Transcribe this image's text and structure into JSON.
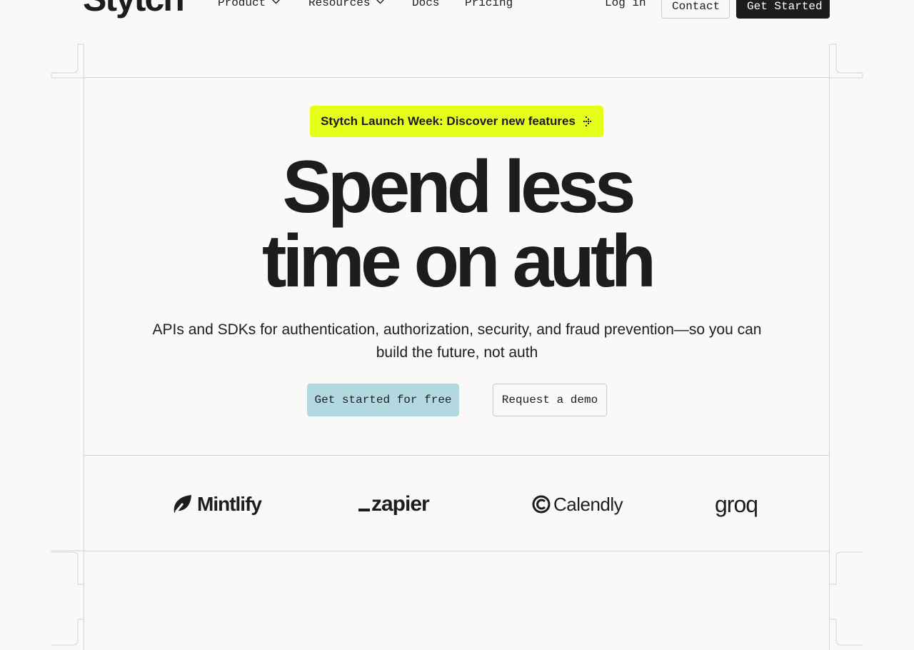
{
  "nav": {
    "logo": "Stytch",
    "links": [
      {
        "label": "Product",
        "has_dropdown": true
      },
      {
        "label": "Resources",
        "has_dropdown": true
      },
      {
        "label": "Docs",
        "has_dropdown": false
      },
      {
        "label": "Pricing",
        "has_dropdown": false
      }
    ],
    "login_label": "Log in",
    "contact_label": "Contact",
    "get_started_label": "Get Started"
  },
  "banner": {
    "text": "Stytch Launch Week: Discover new features",
    "icon": "arrow-right-dots-icon",
    "color": "#e5ff1a"
  },
  "hero": {
    "title_line1": "Spend less",
    "title_line2": "time on auth",
    "subtitle": "APIs and SDKs for authentication, authorization, security, and fraud prevention—so you can build the future, not auth"
  },
  "cta": {
    "primary_label": "Get started for free",
    "primary_color": "#b3d9e0",
    "secondary_label": "Request a demo"
  },
  "customer_logos": [
    {
      "name": "Mintlify",
      "icon": "mintlify-leaf-icon"
    },
    {
      "name": "zapier",
      "icon": "zapier-underscore-mark"
    },
    {
      "name": "Calendly",
      "icon": "calendly-c-icon"
    },
    {
      "name": "groq",
      "icon": null
    }
  ],
  "colors": {
    "background": "#faf9f7",
    "text": "#1d1d1d",
    "frame_lines": "#d3d3d3",
    "dark_button": "#1d1d1d"
  }
}
